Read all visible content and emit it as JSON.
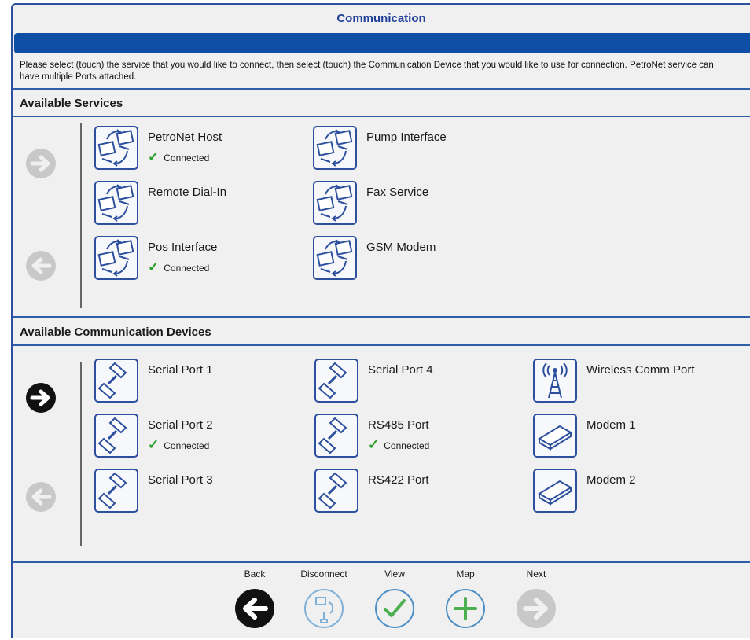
{
  "window": {
    "title": "Communication",
    "instructions": "Please select (touch) the service that you would like to connect, then select (touch) the Communication Device that you would like to use for connection.  PetroNet service can have multiple Ports attached."
  },
  "services": {
    "heading": "Available Services",
    "items": [
      {
        "label": "PetroNet Host",
        "status": "Connected",
        "icon": "network-computers-icon"
      },
      {
        "label": "Pump Interface",
        "status": "",
        "icon": "network-computers-icon"
      },
      {
        "label": "Remote Dial-In",
        "status": "",
        "icon": "network-computers-icon"
      },
      {
        "label": "Fax Service",
        "status": "",
        "icon": "network-computers-icon"
      },
      {
        "label": "Pos Interface",
        "status": "Connected",
        "icon": "network-computers-icon"
      },
      {
        "label": "GSM Modem",
        "status": "",
        "icon": "network-computers-icon"
      }
    ]
  },
  "devices": {
    "heading": "Available Communication Devices",
    "items": [
      {
        "label": "Serial Port 1",
        "status": "",
        "icon": "serial-connector-icon"
      },
      {
        "label": "Serial Port 4",
        "status": "",
        "icon": "serial-connector-icon"
      },
      {
        "label": "Wireless Comm Port",
        "status": "",
        "icon": "antenna-icon"
      },
      {
        "label": "Serial Port 2",
        "status": "Connected",
        "icon": "serial-connector-icon"
      },
      {
        "label": "RS485 Port",
        "status": "Connected",
        "icon": "serial-connector-icon"
      },
      {
        "label": "Modem 1",
        "status": "",
        "icon": "modem-icon"
      },
      {
        "label": "Serial Port 3",
        "status": "",
        "icon": "serial-connector-icon"
      },
      {
        "label": "RS422 Port",
        "status": "",
        "icon": "serial-connector-icon"
      },
      {
        "label": "Modem 2",
        "status": "",
        "icon": "modem-icon"
      }
    ]
  },
  "bottom_nav": {
    "back": "Back",
    "disconnect": "Disconnect",
    "view": "View",
    "map": "Map",
    "next": "Next"
  },
  "colors": {
    "accent": "#0e4ea5",
    "border": "#2c4f9e",
    "check": "#2aa02a",
    "disabled": "#c8c8c8",
    "active_arrow": "#111111"
  }
}
